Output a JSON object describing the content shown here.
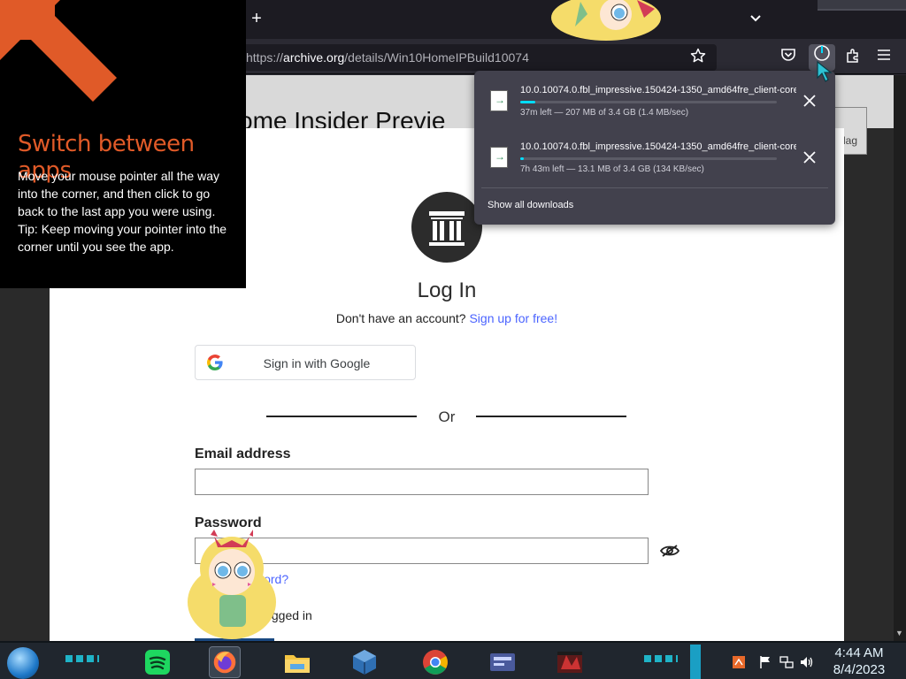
{
  "browser": {
    "new_tab_glyph": "+",
    "tab_list_glyph": "⌄",
    "url_prefix": "https://",
    "url_host": "archive.org",
    "url_path": "/details/Win10HomeIPBuild10074"
  },
  "page": {
    "bg_title": "ome Insider Previe",
    "flag_label": "lag",
    "login_title": "Log In",
    "no_account_text": "Don't have an account?",
    "signup_link": "Sign up for free!",
    "google_button": "Sign in with Google",
    "or_text": "Or",
    "email_label": "Email address",
    "password_label": "Password",
    "forgot_text": "word?",
    "remember_text": "logged in"
  },
  "downloads": {
    "items": [
      {
        "filename": "10.0.10074.0.fbl_impressive.150424-1350_amd64fre_client-core",
        "status": "37m left — 207 MB of 3.4 GB (1.4 MB/sec)",
        "progress": 0.06
      },
      {
        "filename": "10.0.10074.0.fbl_impressive.150424-1350_amd64fre_client-core",
        "status": "7h 43m left — 13.1 MB of 3.4 GB (134 KB/sec)",
        "progress": 0.004
      }
    ],
    "show_all": "Show all downloads"
  },
  "tip": {
    "title": "Switch between apps",
    "body": "Move your mouse pointer all the way into the corner, and then click to go back to the last app you were using.",
    "tip_line": "Tip: Keep moving your pointer into the corner until you see the app."
  },
  "taskbar": {
    "time": "4:44 AM",
    "date": "8/4/2023",
    "apps": [
      "spotify-icon",
      "firefox-icon",
      "file-explorer-icon",
      "virtualbox-icon",
      "chrome-icon",
      "media-center-icon",
      "game-icon"
    ]
  },
  "colors": {
    "accent_orange": "#e05a28",
    "link_blue": "#4b64ff",
    "progress_cyan": "#00ddff"
  }
}
